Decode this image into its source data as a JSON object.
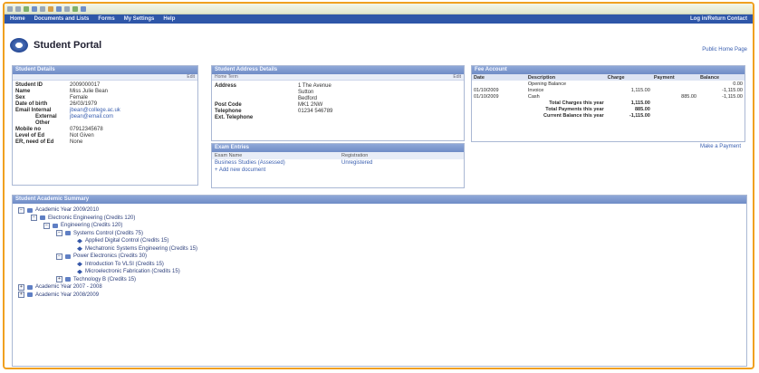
{
  "nav": {
    "items": [
      "Home",
      "Documents and Lists",
      "Forms",
      "My Settings",
      "Help"
    ],
    "right": "Log in/Return Contact"
  },
  "header": {
    "title": "Student Portal",
    "link": "Public Home Page"
  },
  "details": {
    "title": "Student Details",
    "sub": "Edit",
    "rows": [
      {
        "k": "Student ID",
        "v": "2009000017"
      },
      {
        "k": "Name",
        "v": "Miss Julie Bean"
      },
      {
        "k": "Sex",
        "v": "Female"
      },
      {
        "k": "Date of birth",
        "v": "26/03/1979"
      },
      {
        "k": "Email Internal",
        "v": "jbean@college.ac.uk"
      },
      {
        "k": "External",
        "v": "jbean@email.com"
      },
      {
        "k": "Other",
        "v": ""
      },
      {
        "k": "Mobile no",
        "v": "07912345678"
      },
      {
        "k": "Level of Ed",
        "v": "Not Given"
      },
      {
        "k": "ER, need of Ed",
        "v": "None"
      }
    ]
  },
  "address": {
    "title": "Student Address Details",
    "sub_left": "Home Term",
    "sub_right": "Edit",
    "rows": [
      {
        "k": "Address",
        "v": "1 The Avenue"
      },
      {
        "k": "",
        "v": "Sutton"
      },
      {
        "k": "",
        "v": "Bedford"
      },
      {
        "k": "Post Code",
        "v": "MK1 2NW"
      },
      {
        "k": "Telephone",
        "v": "01234 546789"
      },
      {
        "k": "Ext. Telephone",
        "v": ""
      }
    ]
  },
  "fee": {
    "title": "Fee Account",
    "headers": [
      "Date",
      "Description",
      "Charge",
      "Payment",
      "Balance"
    ],
    "rows": [
      {
        "date": "",
        "desc": "Opening Balance",
        "charge": "",
        "payment": "",
        "balance": "0.00"
      },
      {
        "date": "01/10/2009",
        "desc": "Invoice",
        "charge": "1,115.00",
        "payment": "",
        "balance": "-1,115.00"
      },
      {
        "date": "01/10/2009",
        "desc": "Cash",
        "charge": "",
        "payment": "885.00",
        "balance": "-1,115.00"
      }
    ],
    "totals": [
      {
        "label": "Total Charges this year",
        "value": "1,115.00"
      },
      {
        "label": "Total Payments this year",
        "value": "885.00"
      },
      {
        "label": "Current Balance this year",
        "value": "-1,115.00"
      }
    ],
    "make_payment": "Make a Payment"
  },
  "exam": {
    "title": "Exam Entries",
    "headers": [
      "Exam Name",
      "Registration"
    ],
    "rows": [
      {
        "name": "Business Studies (Assessed)",
        "status": "Unregistered"
      }
    ],
    "add": "Add new document"
  },
  "summary": {
    "title": "Student Academic Summary",
    "tree": [
      {
        "level": 0,
        "toggle": "−",
        "icon": "folder",
        "label": "Academic Year 2009/2010"
      },
      {
        "level": 1,
        "toggle": "−",
        "icon": "folder",
        "label": "Electronic Engineering (Credits 120)"
      },
      {
        "level": 2,
        "toggle": "−",
        "icon": "folder",
        "label": "Engineering (Credits 120)"
      },
      {
        "level": 3,
        "toggle": "−",
        "icon": "folder",
        "label": "Systems Control (Credits 75)"
      },
      {
        "level": 4,
        "toggle": "",
        "icon": "leaf",
        "label": "Applied Digital Control (Credits 15)"
      },
      {
        "level": 4,
        "toggle": "",
        "icon": "leaf",
        "label": "Mechatronic Systems Engineering (Credits 15)"
      },
      {
        "level": 3,
        "toggle": "−",
        "icon": "folder",
        "label": "Power Electronics (Credits 30)"
      },
      {
        "level": 4,
        "toggle": "",
        "icon": "leaf",
        "label": "Introduction To VLSI (Credits 15)"
      },
      {
        "level": 4,
        "toggle": "",
        "icon": "leaf",
        "label": "Microelectronic Fabrication (Credits 15)"
      },
      {
        "level": 3,
        "toggle": "+",
        "icon": "folder",
        "label": "Technology B (Credits 15)"
      },
      {
        "level": 0,
        "toggle": "+",
        "icon": "folder",
        "label": "Academic Year 2007 - 2008"
      },
      {
        "level": 0,
        "toggle": "+",
        "icon": "folder",
        "label": "Academic Year 2008/2009"
      }
    ]
  }
}
